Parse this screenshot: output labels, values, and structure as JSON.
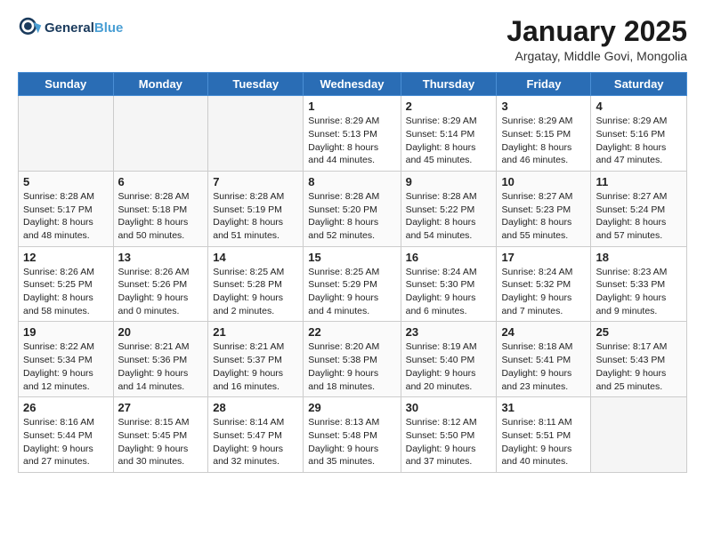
{
  "logo": {
    "line1": "General",
    "line2": "Blue"
  },
  "title": "January 2025",
  "subtitle": "Argatay, Middle Govi, Mongolia",
  "days_of_week": [
    "Sunday",
    "Monday",
    "Tuesday",
    "Wednesday",
    "Thursday",
    "Friday",
    "Saturday"
  ],
  "weeks": [
    [
      {
        "day": "",
        "sunrise": "",
        "sunset": "",
        "daylight": "",
        "empty": true
      },
      {
        "day": "",
        "sunrise": "",
        "sunset": "",
        "daylight": "",
        "empty": true
      },
      {
        "day": "",
        "sunrise": "",
        "sunset": "",
        "daylight": "",
        "empty": true
      },
      {
        "day": "1",
        "sunrise": "Sunrise: 8:29 AM",
        "sunset": "Sunset: 5:13 PM",
        "daylight": "Daylight: 8 hours and 44 minutes."
      },
      {
        "day": "2",
        "sunrise": "Sunrise: 8:29 AM",
        "sunset": "Sunset: 5:14 PM",
        "daylight": "Daylight: 8 hours and 45 minutes."
      },
      {
        "day": "3",
        "sunrise": "Sunrise: 8:29 AM",
        "sunset": "Sunset: 5:15 PM",
        "daylight": "Daylight: 8 hours and 46 minutes."
      },
      {
        "day": "4",
        "sunrise": "Sunrise: 8:29 AM",
        "sunset": "Sunset: 5:16 PM",
        "daylight": "Daylight: 8 hours and 47 minutes."
      }
    ],
    [
      {
        "day": "5",
        "sunrise": "Sunrise: 8:28 AM",
        "sunset": "Sunset: 5:17 PM",
        "daylight": "Daylight: 8 hours and 48 minutes."
      },
      {
        "day": "6",
        "sunrise": "Sunrise: 8:28 AM",
        "sunset": "Sunset: 5:18 PM",
        "daylight": "Daylight: 8 hours and 50 minutes."
      },
      {
        "day": "7",
        "sunrise": "Sunrise: 8:28 AM",
        "sunset": "Sunset: 5:19 PM",
        "daylight": "Daylight: 8 hours and 51 minutes."
      },
      {
        "day": "8",
        "sunrise": "Sunrise: 8:28 AM",
        "sunset": "Sunset: 5:20 PM",
        "daylight": "Daylight: 8 hours and 52 minutes."
      },
      {
        "day": "9",
        "sunrise": "Sunrise: 8:28 AM",
        "sunset": "Sunset: 5:22 PM",
        "daylight": "Daylight: 8 hours and 54 minutes."
      },
      {
        "day": "10",
        "sunrise": "Sunrise: 8:27 AM",
        "sunset": "Sunset: 5:23 PM",
        "daylight": "Daylight: 8 hours and 55 minutes."
      },
      {
        "day": "11",
        "sunrise": "Sunrise: 8:27 AM",
        "sunset": "Sunset: 5:24 PM",
        "daylight": "Daylight: 8 hours and 57 minutes."
      }
    ],
    [
      {
        "day": "12",
        "sunrise": "Sunrise: 8:26 AM",
        "sunset": "Sunset: 5:25 PM",
        "daylight": "Daylight: 8 hours and 58 minutes."
      },
      {
        "day": "13",
        "sunrise": "Sunrise: 8:26 AM",
        "sunset": "Sunset: 5:26 PM",
        "daylight": "Daylight: 9 hours and 0 minutes."
      },
      {
        "day": "14",
        "sunrise": "Sunrise: 8:25 AM",
        "sunset": "Sunset: 5:28 PM",
        "daylight": "Daylight: 9 hours and 2 minutes."
      },
      {
        "day": "15",
        "sunrise": "Sunrise: 8:25 AM",
        "sunset": "Sunset: 5:29 PM",
        "daylight": "Daylight: 9 hours and 4 minutes."
      },
      {
        "day": "16",
        "sunrise": "Sunrise: 8:24 AM",
        "sunset": "Sunset: 5:30 PM",
        "daylight": "Daylight: 9 hours and 6 minutes."
      },
      {
        "day": "17",
        "sunrise": "Sunrise: 8:24 AM",
        "sunset": "Sunset: 5:32 PM",
        "daylight": "Daylight: 9 hours and 7 minutes."
      },
      {
        "day": "18",
        "sunrise": "Sunrise: 8:23 AM",
        "sunset": "Sunset: 5:33 PM",
        "daylight": "Daylight: 9 hours and 9 minutes."
      }
    ],
    [
      {
        "day": "19",
        "sunrise": "Sunrise: 8:22 AM",
        "sunset": "Sunset: 5:34 PM",
        "daylight": "Daylight: 9 hours and 12 minutes."
      },
      {
        "day": "20",
        "sunrise": "Sunrise: 8:21 AM",
        "sunset": "Sunset: 5:36 PM",
        "daylight": "Daylight: 9 hours and 14 minutes."
      },
      {
        "day": "21",
        "sunrise": "Sunrise: 8:21 AM",
        "sunset": "Sunset: 5:37 PM",
        "daylight": "Daylight: 9 hours and 16 minutes."
      },
      {
        "day": "22",
        "sunrise": "Sunrise: 8:20 AM",
        "sunset": "Sunset: 5:38 PM",
        "daylight": "Daylight: 9 hours and 18 minutes."
      },
      {
        "day": "23",
        "sunrise": "Sunrise: 8:19 AM",
        "sunset": "Sunset: 5:40 PM",
        "daylight": "Daylight: 9 hours and 20 minutes."
      },
      {
        "day": "24",
        "sunrise": "Sunrise: 8:18 AM",
        "sunset": "Sunset: 5:41 PM",
        "daylight": "Daylight: 9 hours and 23 minutes."
      },
      {
        "day": "25",
        "sunrise": "Sunrise: 8:17 AM",
        "sunset": "Sunset: 5:43 PM",
        "daylight": "Daylight: 9 hours and 25 minutes."
      }
    ],
    [
      {
        "day": "26",
        "sunrise": "Sunrise: 8:16 AM",
        "sunset": "Sunset: 5:44 PM",
        "daylight": "Daylight: 9 hours and 27 minutes."
      },
      {
        "day": "27",
        "sunrise": "Sunrise: 8:15 AM",
        "sunset": "Sunset: 5:45 PM",
        "daylight": "Daylight: 9 hours and 30 minutes."
      },
      {
        "day": "28",
        "sunrise": "Sunrise: 8:14 AM",
        "sunset": "Sunset: 5:47 PM",
        "daylight": "Daylight: 9 hours and 32 minutes."
      },
      {
        "day": "29",
        "sunrise": "Sunrise: 8:13 AM",
        "sunset": "Sunset: 5:48 PM",
        "daylight": "Daylight: 9 hours and 35 minutes."
      },
      {
        "day": "30",
        "sunrise": "Sunrise: 8:12 AM",
        "sunset": "Sunset: 5:50 PM",
        "daylight": "Daylight: 9 hours and 37 minutes."
      },
      {
        "day": "31",
        "sunrise": "Sunrise: 8:11 AM",
        "sunset": "Sunset: 5:51 PM",
        "daylight": "Daylight: 9 hours and 40 minutes."
      },
      {
        "day": "",
        "sunrise": "",
        "sunset": "",
        "daylight": "",
        "empty": true
      }
    ]
  ]
}
